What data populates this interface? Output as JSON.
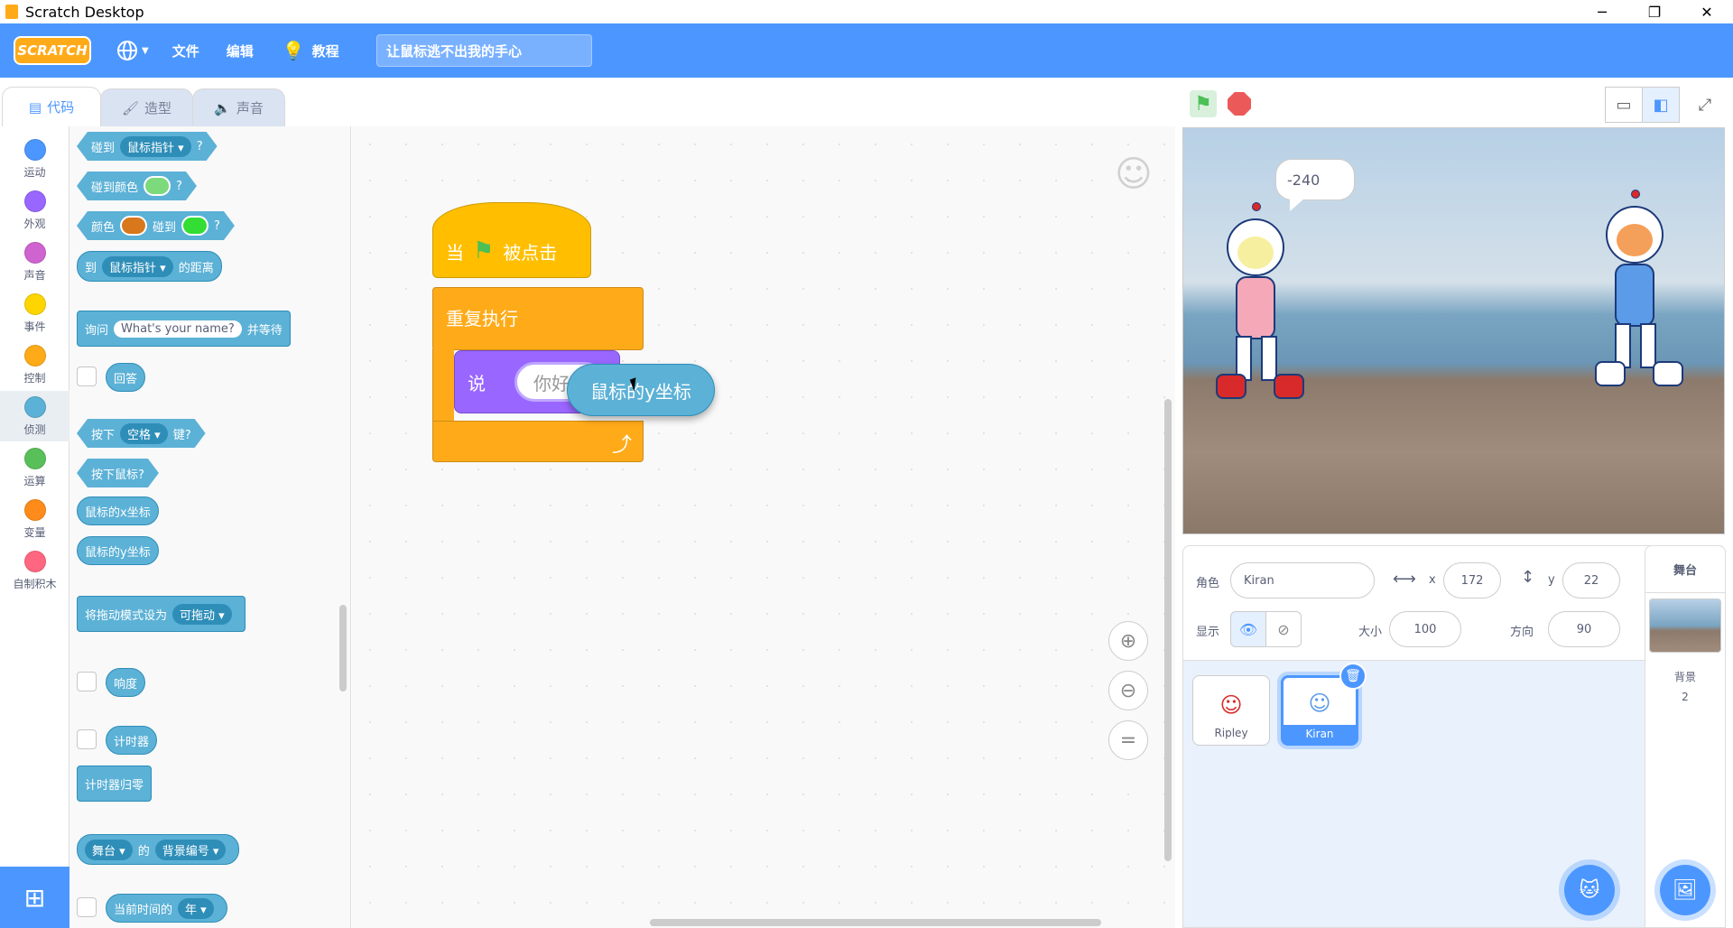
{
  "window": {
    "title": "Scratch Desktop",
    "minimize": "─",
    "restore": "❐",
    "close": "✕"
  },
  "menubar": {
    "logo": "SCRATCH",
    "file": "文件",
    "edit": "编辑",
    "tutorials": "教程",
    "project_title": "让鼠标逃不出我的手心"
  },
  "tabs": [
    {
      "label": "代码"
    },
    {
      "label": "造型"
    },
    {
      "label": "声音"
    }
  ],
  "categories": [
    {
      "label": "运动",
      "color": "#4c97ff"
    },
    {
      "label": "外观",
      "color": "#9966ff"
    },
    {
      "label": "声音",
      "color": "#cf63cf"
    },
    {
      "label": "事件",
      "color": "#ffd500"
    },
    {
      "label": "控制",
      "color": "#ffab19"
    },
    {
      "label": "侦测",
      "color": "#5cb1d6"
    },
    {
      "label": "运算",
      "color": "#59c059"
    },
    {
      "label": "变量",
      "color": "#ff8c1a"
    },
    {
      "label": "自制积木",
      "color": "#ff6680"
    }
  ],
  "palette": {
    "touching": {
      "pre": "碰到",
      "dd": "鼠标指针",
      "post": "?"
    },
    "touching_color": {
      "pre": "碰到颜色",
      "post": "?",
      "color": "#7cd97c"
    },
    "color_touching": {
      "pre": "颜色",
      "mid": "碰到",
      "post": "?",
      "color1": "#d8771c",
      "color2": "#33dd33"
    },
    "distance": {
      "pre": "到",
      "dd": "鼠标指针",
      "post": "的距离"
    },
    "ask": {
      "pre": "询问",
      "input": "What's your name?",
      "post": "并等待"
    },
    "answer": "回答",
    "key": {
      "pre": "按下",
      "dd": "空格",
      "post": "键?"
    },
    "mouse_down": "按下鼠标?",
    "mouse_x": "鼠标的x坐标",
    "mouse_y": "鼠标的y坐标",
    "drag_mode": {
      "pre": "将拖动模式设为",
      "dd": "可拖动"
    },
    "loudness": "响度",
    "timer": "计时器",
    "reset_timer": "计时器归零",
    "of": {
      "dd1": "舞台",
      "mid": "的",
      "dd2": "背景编号"
    },
    "current": {
      "pre": "当前时间的",
      "dd": "年"
    }
  },
  "workspace": {
    "hat": {
      "pre": "当",
      "post": "被点击"
    },
    "forever": "重复执行",
    "say": "说",
    "say_input": "你好",
    "dragging_block": "鼠标的y坐标",
    "loop_arrow": "⤴"
  },
  "stage": {
    "speech": "-240"
  },
  "sprite_info": {
    "sprite_label": "角色",
    "sprite_name": "Kiran",
    "x_label": "x",
    "x_value": "172",
    "y_label": "y",
    "y_value": "22",
    "show_label": "显示",
    "size_label": "大小",
    "size_value": "100",
    "direction_label": "方向",
    "direction_value": "90"
  },
  "sprites": [
    {
      "name": "Ripley"
    },
    {
      "name": "Kiran"
    }
  ],
  "stage_select": {
    "header": "舞台",
    "backdrops_label": "背景",
    "backdrops_count": "2"
  }
}
